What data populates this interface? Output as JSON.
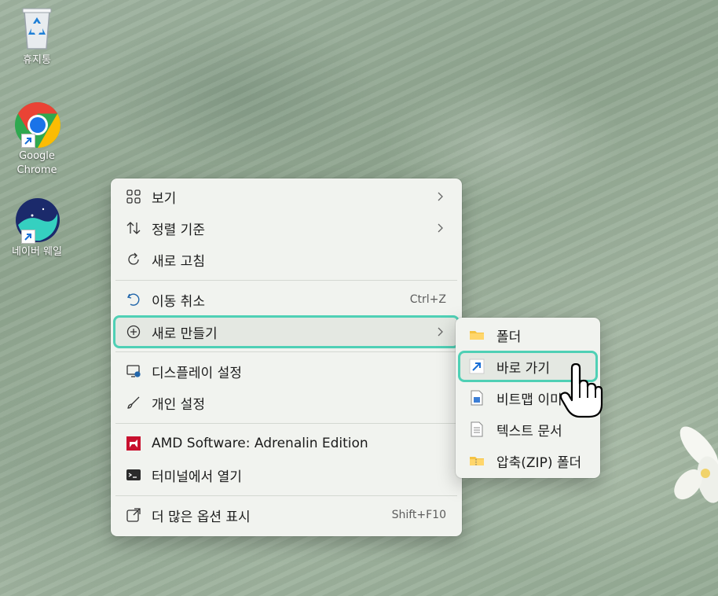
{
  "desktop": {
    "icons": [
      {
        "label": "휴지통"
      },
      {
        "label": "Google\nChrome"
      },
      {
        "label": "네이버 웨일"
      }
    ]
  },
  "context_menu": {
    "items": [
      {
        "label": "보기",
        "shortcut": "",
        "has_submenu": true
      },
      {
        "label": "정렬 기준",
        "shortcut": "",
        "has_submenu": true
      },
      {
        "label": "새로 고침",
        "shortcut": "",
        "has_submenu": false
      },
      {
        "label": "이동 취소",
        "shortcut": "Ctrl+Z",
        "has_submenu": false
      },
      {
        "label": "새로 만들기",
        "shortcut": "",
        "has_submenu": true
      },
      {
        "label": "디스플레이 설정",
        "shortcut": "",
        "has_submenu": false
      },
      {
        "label": "개인 설정",
        "shortcut": "",
        "has_submenu": false
      },
      {
        "label": "AMD Software: Adrenalin Edition",
        "shortcut": "",
        "has_submenu": false
      },
      {
        "label": "터미널에서 열기",
        "shortcut": "",
        "has_submenu": false
      },
      {
        "label": "더 많은 옵션 표시",
        "shortcut": "Shift+F10",
        "has_submenu": false
      }
    ]
  },
  "new_submenu": {
    "items": [
      {
        "label": "폴더"
      },
      {
        "label": "바로 가기"
      },
      {
        "label": "비트맵 이미지"
      },
      {
        "label": "텍스트 문서"
      },
      {
        "label": "압축(ZIP) 폴더"
      }
    ]
  },
  "colors": {
    "highlight_ring": "#4fd0b5",
    "menu_bg": "#f1f3ef"
  }
}
